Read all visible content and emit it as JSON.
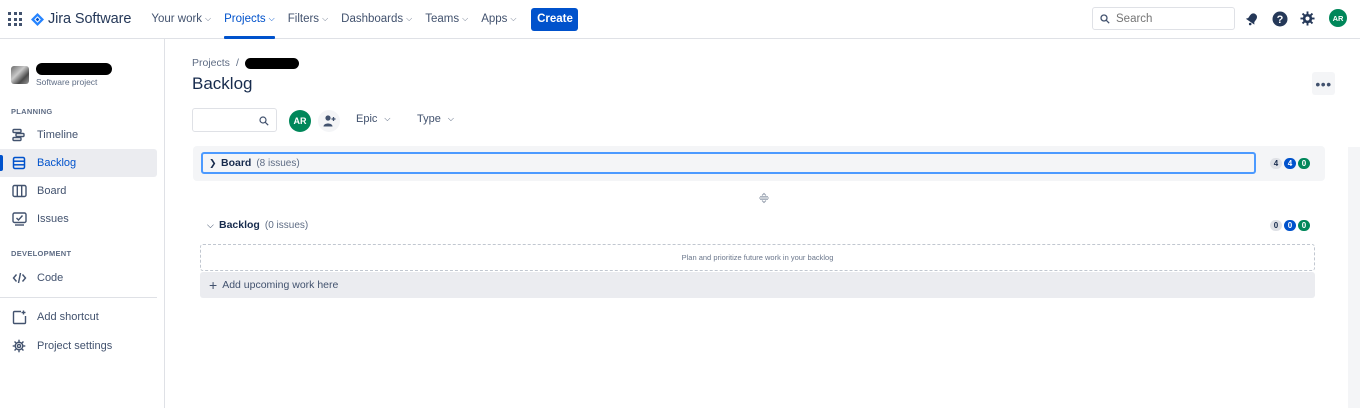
{
  "topnav": {
    "logo_text": "Jira Software",
    "items": [
      {
        "label": "Your work",
        "active": false
      },
      {
        "label": "Projects",
        "active": true
      },
      {
        "label": "Filters",
        "active": false
      },
      {
        "label": "Dashboards",
        "active": false
      },
      {
        "label": "Teams",
        "active": false
      },
      {
        "label": "Apps",
        "active": false
      }
    ],
    "create_label": "Create",
    "search_placeholder": "Search",
    "user_initials": "AR",
    "icons": [
      "notifications-icon",
      "help-icon",
      "settings-icon"
    ]
  },
  "sidebar": {
    "project_type": "Software project",
    "planning_label": "PLANNING",
    "planning_items": [
      {
        "label": "Timeline",
        "icon": "timeline-icon"
      },
      {
        "label": "Backlog",
        "icon": "backlog-icon",
        "active": true
      },
      {
        "label": "Board",
        "icon": "board-icon"
      },
      {
        "label": "Issues",
        "icon": "issues-icon"
      }
    ],
    "development_label": "DEVELOPMENT",
    "development_items": [
      {
        "label": "Code",
        "icon": "code-icon"
      }
    ],
    "footer_items": [
      {
        "label": "Add shortcut",
        "icon": "add-shortcut-icon"
      },
      {
        "label": "Project settings",
        "icon": "settings-icon"
      }
    ]
  },
  "main": {
    "breadcrumb_root": "Projects",
    "breadcrumb_sep": "/",
    "title": "Backlog",
    "more_label": "•••",
    "filter_user_initials": "AR",
    "epic_label": "Epic",
    "type_label": "Type",
    "board_section": {
      "name": "Board",
      "count": "(8 issues)",
      "badges": [
        "4",
        "4",
        "0"
      ]
    },
    "backlog_section": {
      "name": "Backlog",
      "count": "(0 issues)",
      "badges": [
        "0",
        "0",
        "0"
      ],
      "empty_text": "Plan and prioritize future work in your backlog",
      "add_label": "Add upcoming work here"
    }
  },
  "colors": {
    "brand_blue": "#0052cc",
    "green": "#00875a",
    "focus_ring": "#4c9aff",
    "text": "#172b4d"
  }
}
